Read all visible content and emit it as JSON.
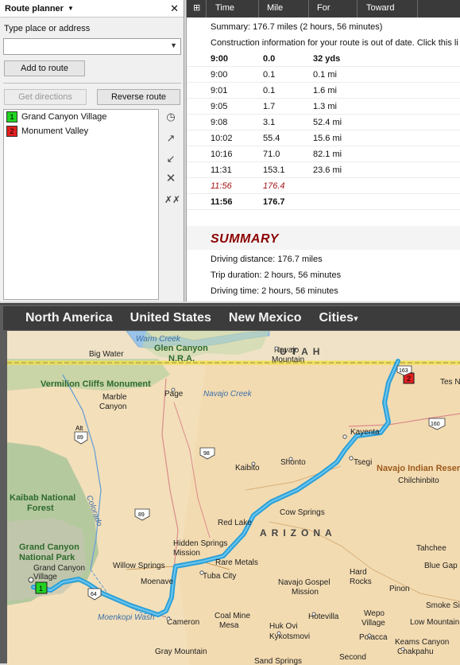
{
  "planner": {
    "title": "Route planner",
    "close_label": "✕",
    "place_label": "Type place or address",
    "place_value": "",
    "add_route_label": "Add to route",
    "get_directions_label": "Get directions",
    "reverse_route_label": "Reverse route",
    "stops": [
      {
        "number": "1",
        "name": "Grand Canyon Village",
        "color": "#22d322"
      },
      {
        "number": "2",
        "name": "Monument Valley",
        "color": "#e02020"
      }
    ]
  },
  "directions": {
    "headers": [
      "Time",
      "Mile",
      "For",
      "Toward"
    ],
    "summary_text": "Summary:  176.7 miles (2 hours, 56 minutes)",
    "construction_note": "Construction information for your route is out of date.  Click this li",
    "rows": [
      {
        "time": "9:00",
        "mile": "0.0",
        "for": "32 yds",
        "bold": true
      },
      {
        "time": "9:00",
        "mile": "0.1",
        "for": "0.1 mi"
      },
      {
        "time": "9:01",
        "mile": "0.1",
        "for": "1.6 mi"
      },
      {
        "time": "9:05",
        "mile": "1.7",
        "for": "1.3 mi"
      },
      {
        "time": "9:08",
        "mile": "3.1",
        "for": "52.4 mi"
      },
      {
        "time": "10:02",
        "mile": "55.4",
        "for": "15.6 mi"
      },
      {
        "time": "10:16",
        "mile": "71.0",
        "for": "82.1 mi"
      },
      {
        "time": "11:31",
        "mile": "153.1",
        "for": "23.6 mi"
      },
      {
        "time": "11:56",
        "mile": "176.4",
        "for": "",
        "waypoint": true
      },
      {
        "time": "11:56",
        "mile": "176.7",
        "for": "",
        "bold": true
      }
    ],
    "summary_heading": "SUMMARY",
    "driving_distance": "Driving distance:  176.7 miles",
    "trip_duration": "Trip duration:  2 hours, 56 minutes",
    "driving_time": "Driving time:  2 hours, 56 minutes"
  },
  "map": {
    "breadcrumbs": [
      "North America",
      "United States",
      "New Mexico",
      "Cities"
    ],
    "cities_caret": "▾",
    "state_label": "ARIZONA",
    "utah_label": "UTAH",
    "route_color": "#2aa0d8",
    "labels": {
      "warm_creek": "Warm Creek",
      "glen_canyon": "Glen Canyon",
      "nra": "N.R.A.",
      "big_water": "Big Water",
      "navajo_mountain_1": "Navajo",
      "navajo_mountain_2": "Mountain",
      "vermilion": "Vermilion Cliffs Monument",
      "page": "Page",
      "navajo_creek": "Navajo Creek",
      "marble_1": "Marble",
      "marble_2": "Canyon",
      "kayenta": "Kayenta",
      "tes_n": "Tes N",
      "tsegi": "Tsegi",
      "shonto": "Shonto",
      "kaibito": "Kaibito",
      "navajo_indian": "Navajo Indian Reser",
      "chilchinbito": "Chilchinbito",
      "kaibab_1": "Kaibab National",
      "kaibab_2": "Forest",
      "cow_springs": "Cow Springs",
      "red_lake": "Red Lake",
      "hidden_springs_1": "Hidden Springs",
      "hidden_springs_2": "Mission",
      "grand_canyon_np_1": "Grand Canyon",
      "grand_canyon_np_2": "National Park",
      "gc_village_1": "Grand Canyon",
      "gc_village_2": "Village",
      "willow_springs": "Willow Springs",
      "rare_metals": "Rare Metals",
      "moenave": "Moenave",
      "tuba_city": "Tuba City",
      "navajo_gospel_1": "Navajo Gospel",
      "navajo_gospel_2": "Mission",
      "hard_rocks_1": "Hard",
      "hard_rocks_2": "Rocks",
      "pinon": "Pinon",
      "tahchee": "Tahchee",
      "blue_gap": "Blue Gap",
      "moenkopi": "Moenkopi Wash",
      "cameron": "Cameron",
      "coal_mine_1": "Coal Mine",
      "coal_mine_2": "Mesa",
      "hotevilla": "Hotevilla",
      "huk_ovi": "Huk Ovi",
      "kykotsmovi": "Kykotsmovi",
      "wepo_1": "Wepo",
      "wepo_2": "Village",
      "smoke_signal": "Smoke Si",
      "low_mountain": "Low Mountain",
      "polacca": "Polacca",
      "keams_canyon": "Keams Canyon",
      "chakpahu": "Chakpahu",
      "gray_mountain": "Gray Mountain",
      "sand_springs": "Sand Springs",
      "second_mesa": "Second",
      "colorado": "Colorado",
      "shield_89a": "89",
      "shield_89": "89",
      "shield_98": "98",
      "shield_160": "160",
      "shield_163": "163",
      "shield_64": "64",
      "shield_alt": "Alt"
    }
  }
}
